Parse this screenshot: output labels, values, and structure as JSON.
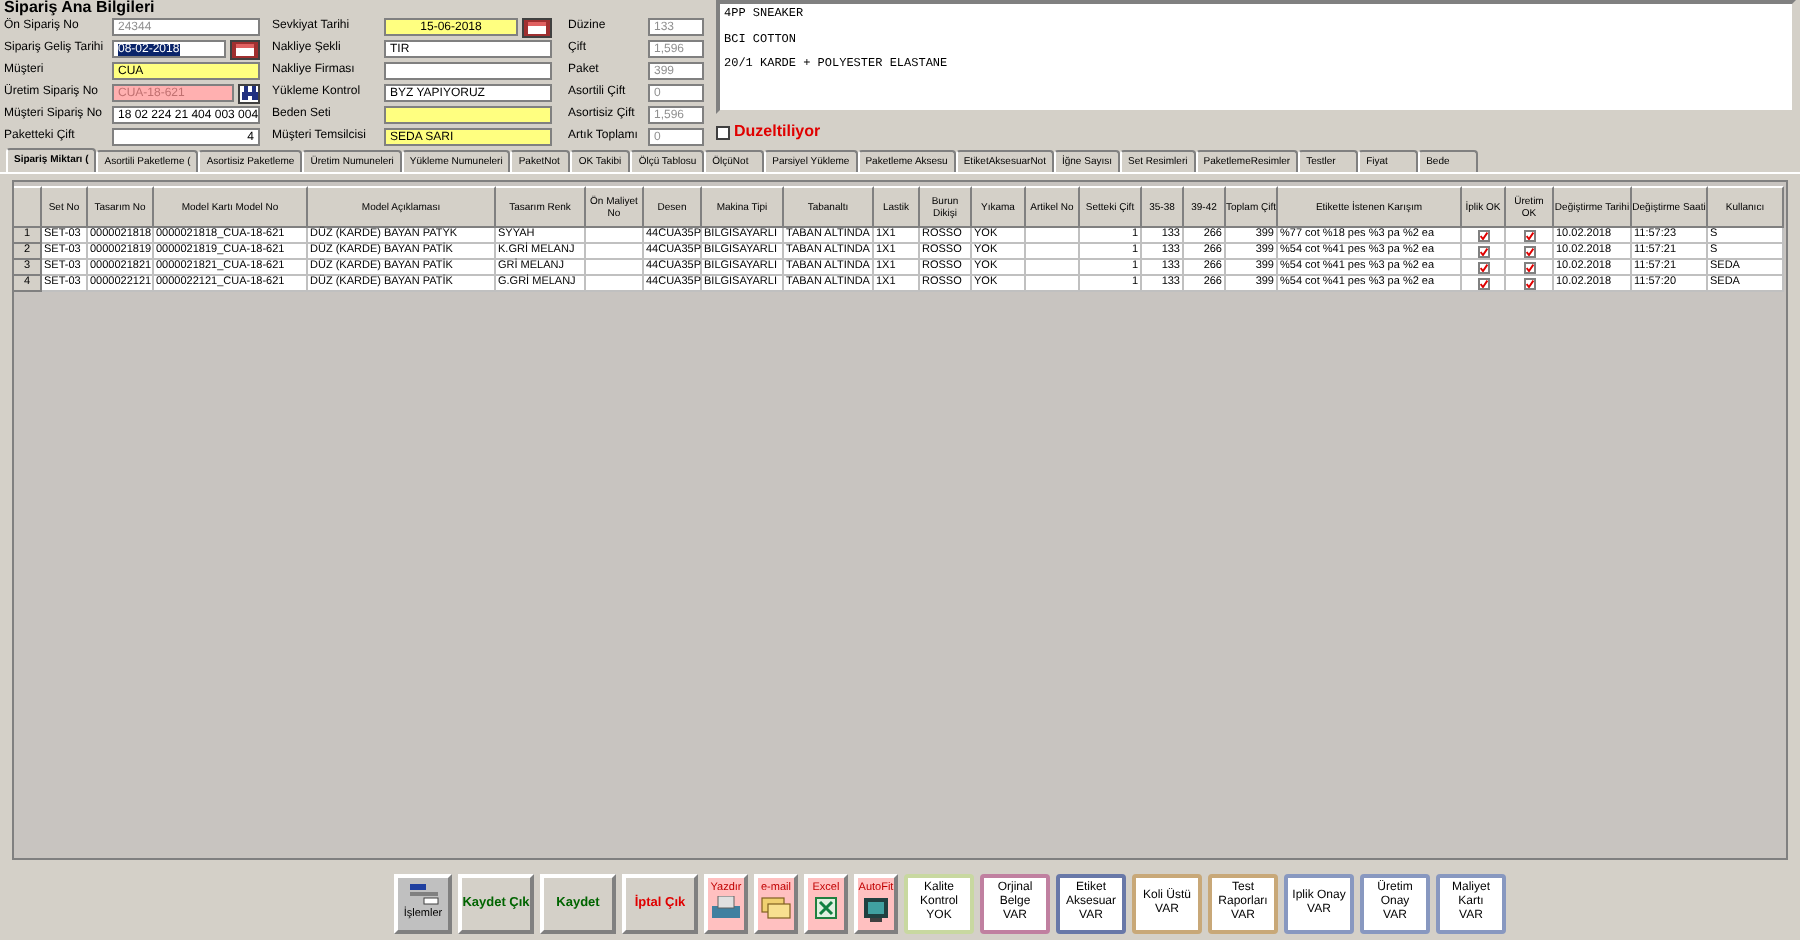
{
  "title": "Sipariş Ana Bilgileri",
  "fields_left": [
    {
      "label": "Ön Sipariş No",
      "value": "24344",
      "kind": "readonly"
    },
    {
      "label": "Sipariş Geliş Tarihi",
      "value": "08-02-2018",
      "kind": "date"
    },
    {
      "label": "Müşteri",
      "value": "CUA",
      "kind": "required"
    },
    {
      "label": "Üretim Sipariş No",
      "value": "CUA-18-621",
      "kind": "lookup"
    },
    {
      "label": "Müşteri Sipariş No",
      "value": "18 02 224 21 404 003 004",
      "kind": "text"
    },
    {
      "label": "Paketteki Çift",
      "value": "4",
      "kind": "count"
    }
  ],
  "fields_middle": [
    {
      "label": "Sevkiyat Tarihi",
      "value": "15-06-2018",
      "kind": "deadline"
    },
    {
      "label": "Nakliye Şekli",
      "value": "TIR",
      "kind": "text"
    },
    {
      "label": "Nakliye Firması",
      "kind": "text"
    },
    {
      "label": "Yükleme Kontrol",
      "value": "BYZ YAPIYORUZ",
      "kind": "text"
    },
    {
      "label": "Beden Seti",
      "kind": "required"
    },
    {
      "label": "Müşteri Temsilcisi",
      "value": "SEDA SARI",
      "kind": "required"
    }
  ],
  "fields_right": [
    {
      "label": "Düzine",
      "value": "133"
    },
    {
      "label": "Çift",
      "value": "1,596"
    },
    {
      "label": "Paket",
      "value": "399"
    },
    {
      "label": "Asortili Çift",
      "value": "0"
    },
    {
      "label": "Asortisiz Çift",
      "value": "1,596"
    },
    {
      "label": "Artık Toplamı",
      "value": "0"
    }
  ],
  "notes": [
    "4PP SNEAKER",
    "BCI COTTON",
    "20/1 KARDE + POLYESTER ELASTANE"
  ],
  "editing": {
    "label": "Duzeltiliyor",
    "checked": false
  },
  "tabs": [
    {
      "label": "Sipariş Miktarı (",
      "selected": true
    },
    {
      "label": "Asortili Paketleme (",
      "selected": false
    },
    {
      "label": "Asortisiz Paketleme",
      "selected": false
    },
    {
      "label": "Üretim Numuneleri",
      "selected": false
    },
    {
      "label": "Yükleme Numuneleri",
      "selected": false
    },
    {
      "label": "PaketNot",
      "selected": false
    },
    {
      "label": "OK Takibi",
      "selected": false
    },
    {
      "label": "Ölçü Tablosu",
      "selected": false
    },
    {
      "label": "ÖlçüNot",
      "selected": false
    },
    {
      "label": "Parsiyel Yükleme",
      "selected": false
    },
    {
      "label": "Paketleme Aksesu",
      "selected": false
    },
    {
      "label": "EtiketAksesuarNot",
      "selected": false
    },
    {
      "label": "İğne Sayısı",
      "selected": false
    },
    {
      "label": "Set Resimleri",
      "selected": false
    },
    {
      "label": "PaketlemeResimler",
      "selected": false
    },
    {
      "label": "Testler",
      "selected": false
    },
    {
      "label": "Fiyat",
      "selected": false
    },
    {
      "label": "Bede",
      "selected": false
    }
  ],
  "table": {
    "columns": [
      {
        "kind": "rownum"
      },
      {
        "label": "Set No",
        "kind": "text"
      },
      {
        "label": "Tasarım No",
        "kind": "text"
      },
      {
        "label": "Model Kartı Model No",
        "kind": "text"
      },
      {
        "label": "Model Açıklaması",
        "kind": "text"
      },
      {
        "label": "Tasarım Renk",
        "kind": "text"
      },
      {
        "label": "Ön Maliyet No",
        "kind": "text"
      },
      {
        "label": "Desen",
        "kind": "text"
      },
      {
        "label": "Makina Tipi",
        "kind": "text"
      },
      {
        "label": "Tabanaltı",
        "kind": "text"
      },
      {
        "label": "Lastik",
        "kind": "text"
      },
      {
        "label": "Burun Dikişi",
        "kind": "text"
      },
      {
        "label": "Yıkama",
        "kind": "text"
      },
      {
        "label": "Artikel No",
        "kind": "text"
      },
      {
        "label": "Setteki Çift",
        "kind": "number"
      },
      {
        "label": "35-38",
        "kind": "number"
      },
      {
        "label": "39-42",
        "kind": "number"
      },
      {
        "label": "Toplam Çift",
        "kind": "number"
      },
      {
        "label": "Etikette İstenen Karışım",
        "kind": "text"
      },
      {
        "label": "İplik OK",
        "kind": "check"
      },
      {
        "label": "Üretim OK",
        "kind": "check"
      },
      {
        "label": "Değiştirme Tarihi",
        "kind": "text"
      },
      {
        "label": "Değiştirme Saati",
        "kind": "text"
      },
      {
        "label": "Kullanıcı",
        "kind": "text"
      }
    ],
    "rows": [
      {
        "cells": [
          "1",
          "SET-03",
          "0000021818",
          "0000021818_CUA-18-621",
          "DÜZ (KARDE) BAYAN PATYK",
          "SYYAH",
          null,
          "44CUA35P",
          "BILGISAYARLI",
          "TABAN ALTINDA",
          "1X1",
          "ROSSO",
          "YOK",
          null,
          "1",
          "133",
          "266",
          "399",
          "%77 cot %18 pes %3 pa %2 ea",
          {
            "checked": true
          },
          {
            "checked": true
          },
          "10.02.2018",
          "11:57:23",
          "S"
        ]
      },
      {
        "cells": [
          "2",
          "SET-03",
          "0000021819",
          "0000021819_CUA-18-621",
          "DÜZ (KARDE) BAYAN PATİK",
          "K.GRİ MELANJ",
          null,
          "44CUA35P",
          "BILGISAYARLI",
          "TABAN ALTINDA",
          "1X1",
          "ROSSO",
          "YOK",
          null,
          "1",
          "133",
          "266",
          "399",
          "%54 cot %41 pes %3 pa %2 ea",
          {
            "checked": true
          },
          {
            "checked": true
          },
          "10.02.2018",
          "11:57:21",
          "S"
        ]
      },
      {
        "cells": [
          "3",
          "SET-03",
          "0000021821",
          "0000021821_CUA-18-621",
          "DÜZ (KARDE) BAYAN PATİK",
          "GRİ MELANJ",
          null,
          "44CUA35P",
          "BILGISAYARLI",
          "TABAN ALTINDA",
          "1X1",
          "ROSSO",
          "YOK",
          null,
          "1",
          "133",
          "266",
          "399",
          "%54 cot %41 pes %3 pa %2 ea",
          {
            "checked": true
          },
          {
            "checked": true
          },
          "10.02.2018",
          "11:57:21",
          "SEDA"
        ]
      },
      {
        "cells": [
          "4",
          "SET-03",
          "0000022121",
          "0000022121_CUA-18-621",
          "DÜZ (KARDE) BAYAN PATİK",
          "G.GRİ MELANJ",
          null,
          "44CUA35P",
          "BILGISAYARLI",
          "TABAN ALTINDA",
          "1X1",
          "ROSSO",
          "YOK",
          null,
          "1",
          "133",
          "266",
          "399",
          "%54 cot %41 pes %3 pa %2 ea",
          {
            "checked": true
          },
          {
            "checked": true
          },
          "10.02.2018",
          "11:57:20",
          "SEDA"
        ]
      }
    ]
  },
  "toolbar": [
    {
      "kind": "icon",
      "label": "İşlemler"
    },
    {
      "kind": "action",
      "label": "Kaydet Çık",
      "color": "#006400"
    },
    {
      "kind": "action",
      "label": "Kaydet",
      "color": "#006400"
    },
    {
      "kind": "action",
      "label": "İptal Çık",
      "color": "#e00000"
    },
    {
      "kind": "printer",
      "label": "Yazdır"
    },
    {
      "kind": "mail",
      "label": "e-mail"
    },
    {
      "kind": "excel",
      "label": "Excel"
    },
    {
      "kind": "fit",
      "label": "AutoFit"
    },
    {
      "kind": "status",
      "label": "Kalite Kontrol",
      "value": "YOK",
      "color": "#c8d8a0"
    },
    {
      "kind": "status",
      "label": "Orjinal Belge",
      "value": "VAR",
      "color": "#c080a0"
    },
    {
      "kind": "status",
      "label": "Etiket Aksesuar",
      "value": "VAR",
      "color": "#6878a8"
    },
    {
      "kind": "status",
      "label": "Koli Üstü",
      "value": "VAR",
      "color": "#c8a878"
    },
    {
      "kind": "status",
      "label": "Test Raporları",
      "value": "VAR",
      "color": "#c8a878"
    },
    {
      "kind": "status",
      "label": "Iplik Onay",
      "value": "VAR",
      "color": "#8898c0"
    },
    {
      "kind": "status",
      "label": "Üretim Onay",
      "value": "VAR",
      "color": "#8898c0"
    },
    {
      "kind": "status",
      "label": "Maliyet Kartı",
      "value": "VAR",
      "color": "#8898c0"
    }
  ]
}
